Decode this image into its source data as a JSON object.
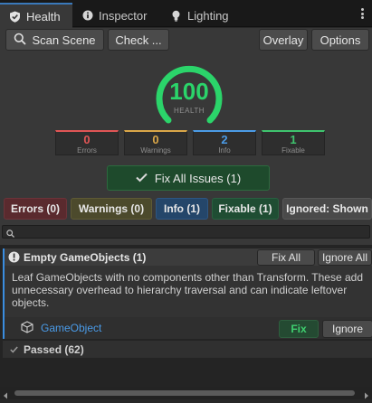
{
  "tabs": [
    {
      "label": "Health",
      "icon": "shield-check-icon",
      "active": true
    },
    {
      "label": "Inspector",
      "icon": "info-icon",
      "active": false
    },
    {
      "label": "Lighting",
      "icon": "lightbulb-icon",
      "active": false
    }
  ],
  "toolbar": {
    "scan_label": "Scan Scene",
    "check_label": "Check ...",
    "overlay_label": "Overlay",
    "options_label": "Options"
  },
  "health": {
    "score": "100",
    "label": "HEALTH",
    "score_fraction": 1.0,
    "color": "#2bd46a"
  },
  "stats": [
    {
      "value": "0",
      "label": "Errors",
      "color": "#e05555"
    },
    {
      "value": "0",
      "label": "Warnings",
      "color": "#d9a648"
    },
    {
      "value": "2",
      "label": "Info",
      "color": "#4b9be6"
    },
    {
      "value": "1",
      "label": "Fixable",
      "color": "#3fc46e"
    }
  ],
  "fix_all_issues_label": "Fix All Issues (1)",
  "filters": [
    {
      "label": "Errors (0)",
      "bg": "#5a2a2e",
      "border": "#6c3339"
    },
    {
      "label": "Warnings (0)",
      "bg": "#4c4a2c",
      "border": "#5e5a34"
    },
    {
      "label": "Info (1)",
      "bg": "#24466a",
      "border": "#2d5682"
    },
    {
      "label": "Fixable (1)",
      "bg": "#1f4d33",
      "border": "#295f40"
    },
    {
      "label": "Ignored: Shown",
      "bg": "#4a4a4a",
      "border": "#575757"
    }
  ],
  "group": {
    "title": "Empty GameObjects (1)",
    "fix_all_label": "Fix All",
    "ignore_all_label": "Ignore All",
    "description": "Leaf GameObjects with no components other than Transform. These add unnecessary overhead to hierarchy traversal and can indicate leftover objects.",
    "object_name": "GameObject",
    "fix_label": "Fix",
    "ignore_label": "Ignore"
  },
  "passed_label": "Passed (62)"
}
